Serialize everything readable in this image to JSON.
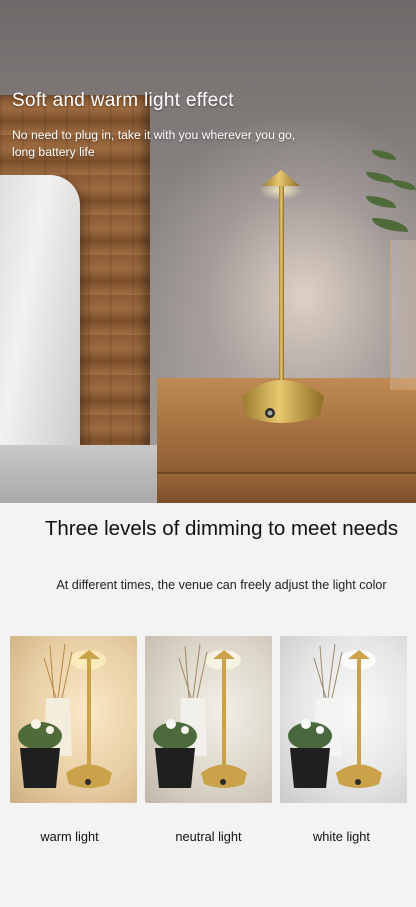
{
  "hero": {
    "title": "Soft and warm light effect",
    "subtitle": "No need to plug in, take it with you wherever you go, long battery life"
  },
  "dimming": {
    "title": "Three levels of dimming to meet needs",
    "description": "At different times, the venue can freely adjust the light color",
    "tiles": [
      {
        "label": "warm light"
      },
      {
        "label": "neutral light"
      },
      {
        "label": "white light"
      }
    ]
  },
  "colors": {
    "lamp_gold": "#c9a24a",
    "warm_bg": "#e8cfa4",
    "neutral_bg": "#dcd6ca",
    "white_bg": "#e6e6e6"
  }
}
